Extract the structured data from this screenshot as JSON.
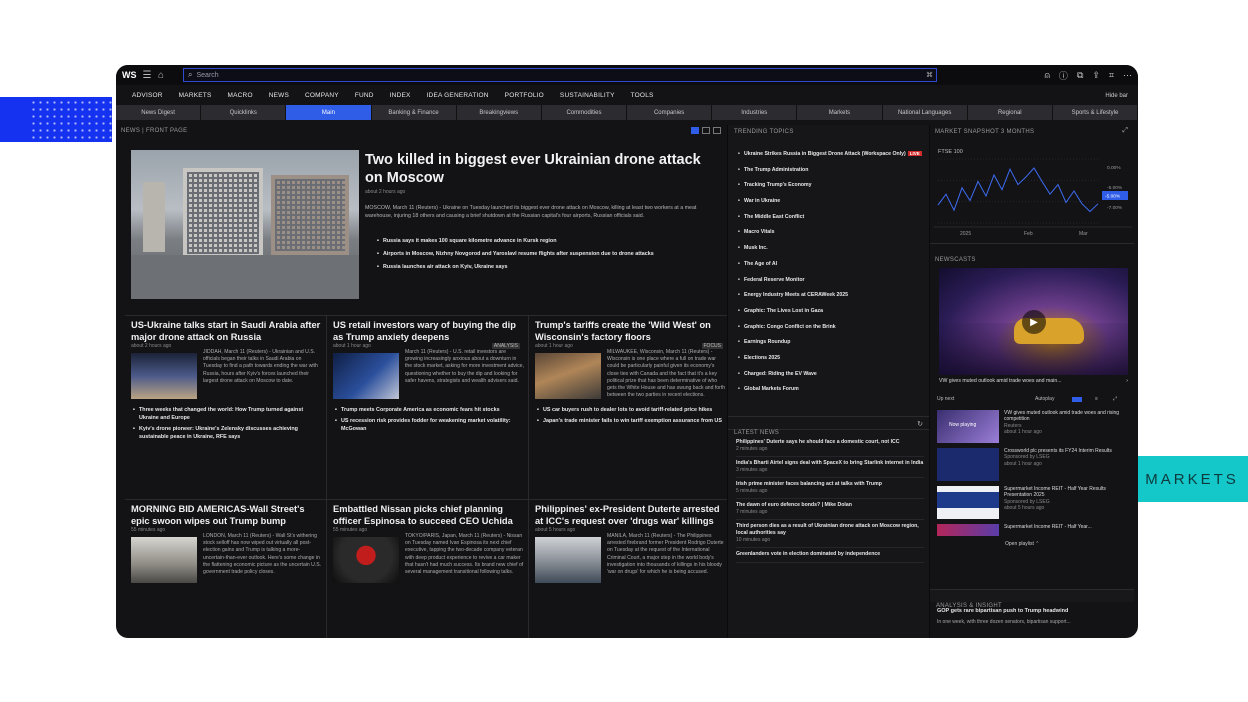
{
  "decor": {
    "markets_label": "MARKETS"
  },
  "topbar": {
    "logo": "WS",
    "search_placeholder": "Search"
  },
  "menu": [
    "ADVISOR",
    "MARKETS",
    "MACRO",
    "NEWS",
    "COMPANY",
    "FUND",
    "INDEX",
    "IDEA GENERATION",
    "PORTFOLIO",
    "SUSTAINABILITY",
    "TOOLS"
  ],
  "menu_hide": "Hide bar",
  "subtabs": [
    "News Digest",
    "Quicklinks",
    "Main",
    "Banking & Finance",
    "Breakingviews",
    "Commodities",
    "Companies",
    "Industries",
    "Markets",
    "National Languages",
    "Regional",
    "Sports & Lifestyle"
  ],
  "active_subtab": "Main",
  "front": {
    "header": "NEWS | FRONT PAGE",
    "hero": {
      "title": "Two killed in biggest ever Ukrainian drone attack on Moscow",
      "meta": "about 2 hours ago",
      "body": "MOSCOW, March 11 (Reuters) - Ukraine on Tuesday launched its biggest ever drone attack on Moscow, killing at least two workers at a meat warehouse, injuring 18 others and causing a brief shutdown at the Russian capital's four airports, Russian officials said.",
      "bullets": [
        "Russia says it makes 100 square kilometre advance in Kursk region",
        "Airports in Moscow, Nizhny Novgorod and Yaroslavl resume flights after suspension due to drone attacks",
        "Russia launches air attack on Kyiv, Ukraine says"
      ]
    },
    "row1": [
      {
        "title": "US-Ukraine talks start in Saudi Arabia after major drone attack on Russia",
        "meta": "about 2 hours ago",
        "tag": "",
        "body": "JIDDAH, March 11 (Reuters) - Ukrainian and U.S. officials began their talks in Saudi Arabia on Tuesday to find a path towards ending the war with Russia, hours after Kyiv's forces launched their largest drone attack on Moscow to date.",
        "bullets": [
          "Three weeks that changed the world: How Trump turned against Ukraine and Europe",
          "Kyiv's drone pioneer: Ukraine's Zelensky discusses achieving sustainable peace in Ukraine, RFE says"
        ]
      },
      {
        "title": "US retail investors wary of buying the dip as Trump anxiety deepens",
        "meta": "about 1 hour ago",
        "tag": "ANALYSIS",
        "body": "March 11 (Reuters) - U.S. retail investors are growing increasingly anxious about a downturn in the stock market, asking for more investment advice, questioning whether to buy the dip and looking for safer havens, strategists and wealth advisers said.",
        "bullets": [
          "Trump meets Corporate America as economic fears hit stocks",
          "US recession risk provides fodder for weakening market volatility: McGowan"
        ]
      },
      {
        "title": "Trump's tariffs create the 'Wild West' on Wisconsin's factory floors",
        "meta": "about 1 hour ago",
        "tag": "FOCUS",
        "body": "MILWAUKEE, Wisconsin, March 11 (Reuters) - Wisconsin is one place where a full on trade war could be particularly painful given its economy's close ties with Canada and the fact that it's a key political prize that has been determinative of who gets the White House and has swung back and forth between the two parties in recent elections.",
        "bullets": [
          "US car buyers rush to dealer lots to avoid tariff-related price hikes",
          "Japan's trade minister fails to win tariff exemption assurance from US"
        ]
      }
    ],
    "row2": [
      {
        "title": "MORNING BID AMERICAS-Wall Street's epic swoon wipes out Trump bump",
        "meta": "55 minutes ago",
        "tag": "",
        "body": "LONDON, March 11 (Reuters) - Wall St's withering stock selloff has now wiped out virtually all post-election gains and Trump is talking a more-uncertain-than-ever outlook. Here's some change in the flattening economic picture as the uncertain U.S. government trade policy closes.",
        "bullets": []
      },
      {
        "title": "Embattled Nissan picks chief planning officer Espinosa to succeed CEO Uchida",
        "meta": "55 minutes ago",
        "tag": "",
        "body": "TOKYO/PARIS, Japan, March 11 (Reuters) - Nissan on Tuesday named Ivan Espinosa its next chief executive, tapping the two-decade company veteran with deep product experience to revive a car maker that hasn't had much success. Its brand new chief of several management transitional following talks.",
        "bullets": []
      },
      {
        "title": "Philippines' ex-President Duterte arrested at ICC's request over 'drugs war' killings",
        "meta": "about 5 hours ago",
        "tag": "",
        "body": "MANILA, March 11 (Reuters) - The Philippines arrested firebrand former President Rodrigo Duterte on Tuesday at the request of the International Criminal Court, a major step in the world body's investigation into thousands of killings in his bloody 'war on drugs' for which he is being accused.",
        "bullets": []
      }
    ]
  },
  "trending": {
    "header": "TRENDING TOPICS",
    "live_label": "LIVE",
    "items": [
      "Ukraine Strikes Russia in Biggest Drone Attack (Workspace Only)",
      "The Trump Administration",
      "Tracking Trump's Economy",
      "War in Ukraine",
      "The Middle East Conflict",
      "Macro Vitals",
      "Musk Inc.",
      "The Age of AI",
      "Federal Reserve Monitor",
      "Energy Industry Meets at CERAWeek 2025",
      "Graphic: The Lives Lost in Gaza",
      "Graphic: Congo Conflict on the Brink",
      "Earnings Roundup",
      "Elections 2025",
      "Charged: Riding the EV Wave",
      "Global Markets Forum"
    ]
  },
  "latest": {
    "header": "LATEST NEWS",
    "items": [
      {
        "title": "Philippines' Duterte says he should face a domestic court, not ICC",
        "meta": "2 minutes ago"
      },
      {
        "title": "India's Bharti Airtel signs deal with SpaceX to bring Starlink internet in India",
        "meta": "3 minutes ago"
      },
      {
        "title": "Irish prime minister faces balancing act at talks with Trump",
        "meta": "5 minutes ago"
      },
      {
        "title": "The dawn of euro defence bonds? | Mike Dolan",
        "meta": "7 minutes ago"
      },
      {
        "title": "Third person dies as a result of Ukrainian drone attack on Moscow region, local authorities say",
        "meta": "10 minutes ago"
      },
      {
        "title": "Greenlanders vote in election dominated by independence",
        "meta": ""
      }
    ]
  },
  "market": {
    "header": "MARKET SNAPSHOT 3 MONTHS",
    "index_label": "FTSE 100",
    "right_labels": [
      "0.00%",
      "-5.00%",
      "-7.00%",
      "0.00%"
    ],
    "current_label": "-5.00%",
    "x_labels": [
      "2025",
      "Feb",
      "Mar"
    ]
  },
  "chart_data": {
    "type": "line",
    "title": "FTSE 100",
    "xlabel": "",
    "ylabel": "",
    "x": [
      "2025",
      "Feb",
      "Mar"
    ],
    "series": [
      {
        "name": "FTSE 100",
        "values": [
          -5.2,
          -3.5,
          -6.0,
          -2.5,
          -4.5,
          -1.5,
          -3.8,
          -0.5,
          -2.8,
          0.4,
          -2.0,
          -0.8,
          0.6,
          -1.5,
          -3.5,
          -2.0,
          -4.8,
          -3.0,
          -5.0,
          -6.2,
          -5.0
        ]
      }
    ],
    "ylim": [
      -8,
      2
    ],
    "grid": true
  },
  "newscasts": {
    "header": "NEWSCASTS",
    "featured_caption": "VW gives muted outlook amid trade woes and main...",
    "up_next": "Up next",
    "autoplay": "Autoplay",
    "videos": [
      {
        "badge": "Now playing",
        "title": "VW gives muted outlook amid trade woes and rising competition",
        "source": "Reuters",
        "time": "about 1 hour ago"
      },
      {
        "badge": "",
        "title": "Crossworld plc presents its FY24 Interim Results",
        "source": "Sponsored by LSEG",
        "time": "about 1 hour ago"
      },
      {
        "badge": "",
        "title": "Supermarket Income REIT - Half Year Results Presentation 2025",
        "source": "Sponsored by LSEG",
        "time": "about 5 hours ago"
      },
      {
        "badge": "",
        "title": "Supermarket Income REIT - Half Year...",
        "source": "",
        "time": ""
      }
    ],
    "open_playlist": "Open playlist"
  },
  "analysis": {
    "header": "ANALYSIS & INSIGHT",
    "lead": "GOP gets rare bipartisan push to Trump headwind",
    "body": "In one week, with three dozen senators, bipartisan support..."
  }
}
